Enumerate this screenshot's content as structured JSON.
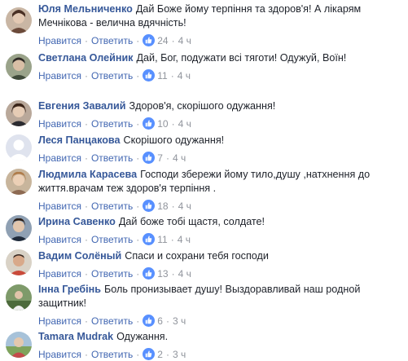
{
  "colors": {
    "author": "#365899",
    "action_link": "#4267b2",
    "meta": "#90949c",
    "text": "#1d2129",
    "like_badge": "#5890ff"
  },
  "actions": {
    "like_label": "Нравится",
    "reply_label": "Ответить",
    "separator": "·"
  },
  "comments": [
    {
      "author": "Юля Мельниченко",
      "text": "Дай Боже йому терпіння та здоров'я! А лікарям Мечнікова - велична вдячність!",
      "likes": "24",
      "time": "4 ч",
      "avatar_icon": "avatar-photo"
    },
    {
      "author": "Светлана Олейник",
      "text": "Дай, Бог, подужати всі тяготи! Одужуй, Воїн!",
      "likes": "11",
      "time": "4 ч",
      "avatar_icon": "avatar-photo"
    },
    {
      "author": "Евгения Завалий",
      "text": "Здоров'я, скорішого одужання!",
      "likes": "10",
      "time": "4 ч",
      "avatar_icon": "avatar-photo"
    },
    {
      "author": "Леся Панцакова",
      "text": "Скорішого одужання!",
      "likes": "7",
      "time": "4 ч",
      "avatar_icon": "default-avatar-icon"
    },
    {
      "author": "Людмила Карасева",
      "text": "Господи збережи йому тило,душу ,натхнення до життя.врачам теж здоров'я терпіння .",
      "likes": "18",
      "time": "4 ч",
      "avatar_icon": "avatar-photo"
    },
    {
      "author": "Ирина Савенко",
      "text": "Дай боже тобі щастя, солдате!",
      "likes": "11",
      "time": "4 ч",
      "avatar_icon": "avatar-photo"
    },
    {
      "author": "Вадим Солёный",
      "text": "Спаси и сохрани тебя господи",
      "likes": "13",
      "time": "4 ч",
      "avatar_icon": "avatar-photo"
    },
    {
      "author": "Інна Гребінь",
      "text": "Боль пронизывает душу! Выздоравливай наш родной защитник!",
      "likes": "6",
      "time": "3 ч",
      "avatar_icon": "avatar-photo"
    },
    {
      "author": "Tamara Mudrak",
      "text": "Одужання.",
      "likes": "2",
      "time": "3 ч",
      "avatar_icon": "avatar-photo"
    }
  ]
}
